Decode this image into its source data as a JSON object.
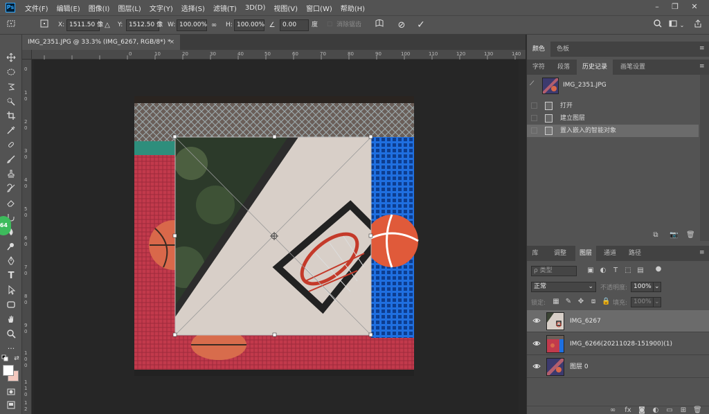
{
  "app": {
    "logo_text": "Ps"
  },
  "menu": [
    "文件(F)",
    "编辑(E)",
    "图像(I)",
    "图层(L)",
    "文字(Y)",
    "选择(S)",
    "滤镜(T)",
    "3D(D)",
    "视图(V)",
    "窗口(W)",
    "帮助(H)"
  ],
  "options": {
    "x_label": "X:",
    "x_value": "1511.50 像",
    "y_label": "Y:",
    "y_value": "1512.50 像",
    "w_label": "W:",
    "w_value": "100.00%",
    "h_label": "H:",
    "h_value": "100.00%",
    "angle_value": "0.00",
    "angle_unit": "度",
    "antialias_label": "消除锯齿"
  },
  "document": {
    "tab_title": "IMG_2351.JPG @ 33.3% (IMG_6267, RGB/8*) *",
    "tab_close": "×",
    "ruler_h": [
      "0",
      "10",
      "20",
      "30",
      "40",
      "50",
      "60",
      "70",
      "80",
      "90",
      "100",
      "110",
      "120",
      "130",
      "140"
    ],
    "ruler_v": [
      "0",
      "1",
      "0",
      "2",
      "0",
      "3",
      "0",
      "4",
      "0",
      "5",
      "0",
      "6",
      "0",
      "7",
      "0",
      "8",
      "0",
      "9",
      "0",
      "1",
      "0",
      "0",
      "1",
      "1",
      "0",
      "1",
      "2"
    ]
  },
  "badge": "64",
  "panels": {
    "color_tabs": [
      "颜色",
      "色板"
    ],
    "history_tabs": [
      "字符",
      "段落",
      "历史记录",
      "画笔设置"
    ],
    "history_doc": "IMG_2351.JPG",
    "history_items": [
      "打开",
      "建立图层",
      "置入嵌入的智能对象"
    ],
    "layers_tabs": [
      "库",
      "调整",
      "图层",
      "通道",
      "路径"
    ],
    "kind_filter": "ρ 类型",
    "blend_mode": "正常",
    "opacity_label": "不透明度:",
    "opacity_value": "100%",
    "lock_label": "锁定:",
    "fill_label": "填充:",
    "fill_value": "100%",
    "layers": [
      {
        "name": "IMG_6267",
        "selected": true
      },
      {
        "name": "IMG_6266(20211028-151900)(1)",
        "selected": false
      },
      {
        "name": "图层 0",
        "selected": false
      }
    ]
  },
  "colors": {
    "accent_blue": "#31a8ff",
    "badge_green": "#3dbb5c",
    "panel_bg": "#535353",
    "selected_row": "#6b6b6b"
  }
}
